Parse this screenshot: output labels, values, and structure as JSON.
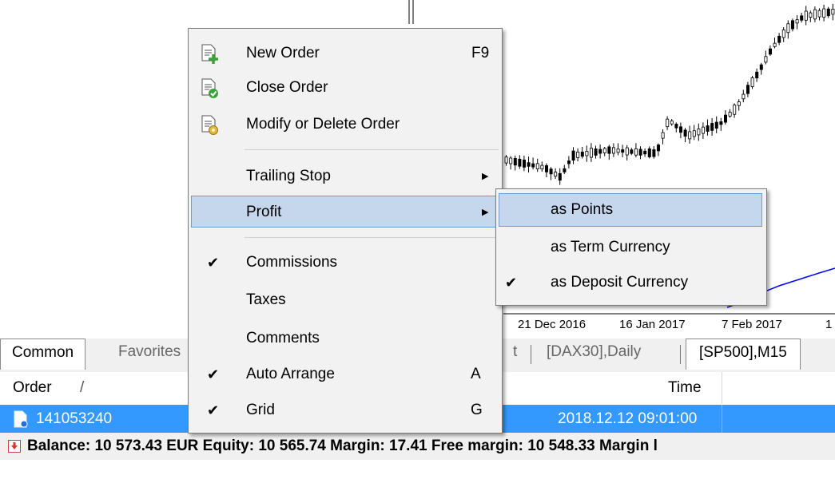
{
  "chart": {
    "date_labels": [
      "21 Dec 2016",
      "16 Jan 2017",
      "7 Feb 2017",
      "1"
    ],
    "colors": {
      "candle": "#000000",
      "indicator": "#0000ff"
    }
  },
  "context_menu": {
    "items": [
      {
        "label": "New Order",
        "shortcut": "F9",
        "icon": "new-order-icon"
      },
      {
        "label": "Close Order",
        "icon": "close-order-icon"
      },
      {
        "label": "Modify or Delete Order",
        "icon": "modify-order-icon"
      },
      {
        "label": "Trailing Stop",
        "has_submenu": true
      },
      {
        "label": "Profit",
        "has_submenu": true,
        "highlighted": true
      },
      {
        "label": "Commissions",
        "checked": true
      },
      {
        "label": "Taxes"
      },
      {
        "label": "Comments"
      },
      {
        "label": "Auto Arrange",
        "shortcut": "A",
        "checked": true
      },
      {
        "label": "Grid",
        "shortcut": "G",
        "checked": true
      }
    ]
  },
  "profit_submenu": {
    "items": [
      {
        "label": "as Points",
        "highlighted": true
      },
      {
        "label": "as Term Currency"
      },
      {
        "label": "as Deposit Currency",
        "checked": true
      }
    ]
  },
  "tabs": {
    "items": [
      "Common",
      "Favorites",
      "t",
      "[DAX30],Daily",
      "[SP500],M15"
    ]
  },
  "terminal": {
    "headers": {
      "order": "Order",
      "sort_mark": "/",
      "time": "Time"
    },
    "row": {
      "order": "141053240",
      "time": "2018.12.12 09:01:00"
    },
    "status": "Balance: 10 573.43 EUR  Equity: 10 565.74  Margin: 17.41  Free margin: 10 548.33  Margin l"
  },
  "symbols": {
    "check": "✔",
    "submenu_arrow": "▶"
  }
}
